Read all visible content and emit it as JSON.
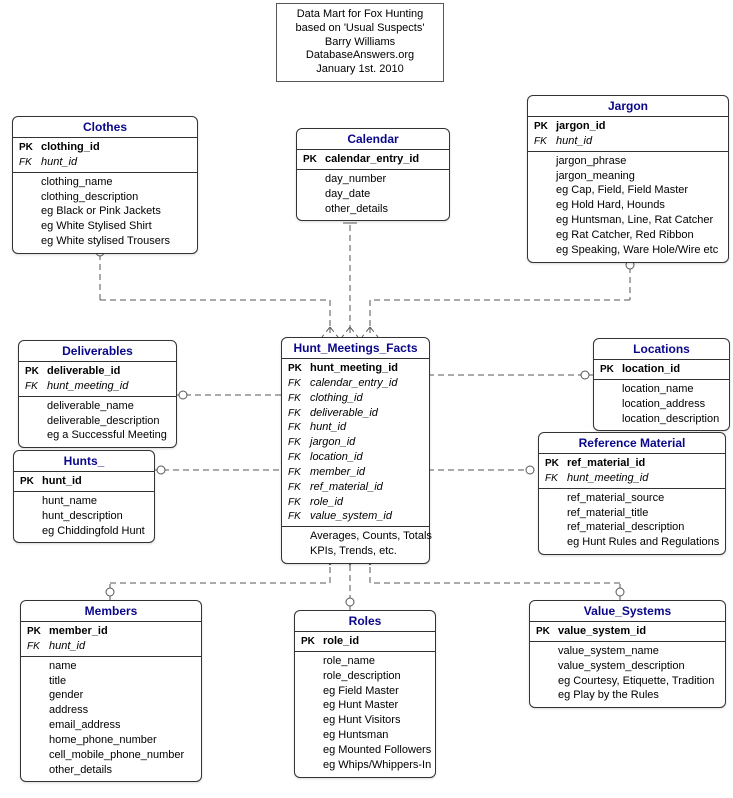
{
  "title_box": {
    "line1": "Data Mart for Fox Hunting",
    "line2": "based on 'Usual Suspects'",
    "line3": "Barry Williams",
    "line4": "DatabaseAnswers.org",
    "line5": "January 1st. 2010"
  },
  "entities": {
    "clothes": {
      "title": "Clothes",
      "rows": [
        {
          "key": "PK",
          "field": "clothing_id",
          "kind": "pk"
        },
        {
          "key": "FK",
          "field": "hunt_id",
          "kind": "fk"
        },
        {
          "key": "",
          "field": "clothing_name",
          "kind": "attr"
        },
        {
          "key": "",
          "field": "clothing_description",
          "kind": "attr"
        },
        {
          "key": "",
          "field": "eg Black or Pink Jackets",
          "kind": "attr"
        },
        {
          "key": "",
          "field": "eg White Stylised Shirt",
          "kind": "attr"
        },
        {
          "key": "",
          "field": "eg White stylised Trousers",
          "kind": "attr"
        }
      ]
    },
    "calendar": {
      "title": "Calendar",
      "rows": [
        {
          "key": "PK",
          "field": "calendar_entry_id",
          "kind": "pk"
        },
        {
          "key": "",
          "field": "day_number",
          "kind": "attr"
        },
        {
          "key": "",
          "field": "day_date",
          "kind": "attr"
        },
        {
          "key": "",
          "field": "other_details",
          "kind": "attr"
        }
      ]
    },
    "jargon": {
      "title": "Jargon",
      "rows": [
        {
          "key": "PK",
          "field": "jargon_id",
          "kind": "pk"
        },
        {
          "key": "FK",
          "field": "hunt_id",
          "kind": "fk"
        },
        {
          "key": "",
          "field": "jargon_phrase",
          "kind": "attr"
        },
        {
          "key": "",
          "field": "jargon_meaning",
          "kind": "attr"
        },
        {
          "key": "",
          "field": "eg Cap, Field, Field Master",
          "kind": "attr"
        },
        {
          "key": "",
          "field": "eg Hold Hard, Hounds",
          "kind": "attr"
        },
        {
          "key": "",
          "field": "eg Huntsman, Line, Rat Catcher",
          "kind": "attr"
        },
        {
          "key": "",
          "field": "eg Rat Catcher, Red Ribbon",
          "kind": "attr"
        },
        {
          "key": "",
          "field": "eg Speaking, Ware Hole/Wire etc",
          "kind": "attr"
        }
      ]
    },
    "deliverables": {
      "title": "Deliverables",
      "rows": [
        {
          "key": "PK",
          "field": "deliverable_id",
          "kind": "pk"
        },
        {
          "key": "FK",
          "field": "hunt_meeting_id",
          "kind": "fk"
        },
        {
          "key": "",
          "field": "deliverable_name",
          "kind": "attr"
        },
        {
          "key": "",
          "field": "deliverable_description",
          "kind": "attr"
        },
        {
          "key": "",
          "field": "eg a Successful Meeting",
          "kind": "attr"
        }
      ]
    },
    "facts": {
      "title": "Hunt_Meetings_Facts",
      "rows": [
        {
          "key": "PK",
          "field": "hunt_meeting_id",
          "kind": "pk"
        },
        {
          "key": "FK",
          "field": "calendar_entry_id",
          "kind": "fk"
        },
        {
          "key": "FK",
          "field": "clothing_id",
          "kind": "fk"
        },
        {
          "key": "FK",
          "field": "deliverable_id",
          "kind": "fk"
        },
        {
          "key": "FK",
          "field": "hunt_id",
          "kind": "fk"
        },
        {
          "key": "FK",
          "field": "jargon_id",
          "kind": "fk"
        },
        {
          "key": "FK",
          "field": "location_id",
          "kind": "fk"
        },
        {
          "key": "FK",
          "field": "member_id",
          "kind": "fk"
        },
        {
          "key": "FK",
          "field": "ref_material_id",
          "kind": "fk"
        },
        {
          "key": "FK",
          "field": "role_id",
          "kind": "fk"
        },
        {
          "key": "FK",
          "field": "value_system_id",
          "kind": "fk"
        },
        {
          "key": "",
          "field": "Averages, Counts, Totals",
          "kind": "attr"
        },
        {
          "key": "",
          "field": "KPIs, Trends, etc.",
          "kind": "attr"
        }
      ]
    },
    "locations": {
      "title": "Locations",
      "rows": [
        {
          "key": "PK",
          "field": "location_id",
          "kind": "pk"
        },
        {
          "key": "",
          "field": "location_name",
          "kind": "attr"
        },
        {
          "key": "",
          "field": "location_address",
          "kind": "attr"
        },
        {
          "key": "",
          "field": "location_description",
          "kind": "attr"
        }
      ]
    },
    "hunts": {
      "title": "Hunts_",
      "rows": [
        {
          "key": "PK",
          "field": "hunt_id",
          "kind": "pk"
        },
        {
          "key": "",
          "field": "hunt_name",
          "kind": "attr"
        },
        {
          "key": "",
          "field": "hunt_description",
          "kind": "attr"
        },
        {
          "key": "",
          "field": "eg Chiddingfold Hunt",
          "kind": "attr"
        }
      ]
    },
    "refmat": {
      "title": "Reference Material",
      "rows": [
        {
          "key": "PK",
          "field": "ref_material_id",
          "kind": "pk"
        },
        {
          "key": "FK",
          "field": "hunt_meeting_id",
          "kind": "fk"
        },
        {
          "key": "",
          "field": "ref_material_source",
          "kind": "attr"
        },
        {
          "key": "",
          "field": "ref_material_title",
          "kind": "attr"
        },
        {
          "key": "",
          "field": "ref_material_description",
          "kind": "attr"
        },
        {
          "key": "",
          "field": "eg Hunt Rules and Regulations",
          "kind": "attr"
        }
      ]
    },
    "members": {
      "title": "Members",
      "rows": [
        {
          "key": "PK",
          "field": "member_id",
          "kind": "pk"
        },
        {
          "key": "FK",
          "field": "hunt_id",
          "kind": "fk"
        },
        {
          "key": "",
          "field": "name",
          "kind": "attr"
        },
        {
          "key": "",
          "field": "title",
          "kind": "attr"
        },
        {
          "key": "",
          "field": "gender",
          "kind": "attr"
        },
        {
          "key": "",
          "field": "address",
          "kind": "attr"
        },
        {
          "key": "",
          "field": "email_address",
          "kind": "attr"
        },
        {
          "key": "",
          "field": "home_phone_number",
          "kind": "attr"
        },
        {
          "key": "",
          "field": "cell_mobile_phone_number",
          "kind": "attr"
        },
        {
          "key": "",
          "field": "other_details",
          "kind": "attr"
        }
      ]
    },
    "roles": {
      "title": "Roles",
      "rows": [
        {
          "key": "PK",
          "field": "role_id",
          "kind": "pk"
        },
        {
          "key": "",
          "field": "role_name",
          "kind": "attr"
        },
        {
          "key": "",
          "field": "role_description",
          "kind": "attr"
        },
        {
          "key": "",
          "field": "eg Field Master",
          "kind": "attr"
        },
        {
          "key": "",
          "field": "eg Hunt Master",
          "kind": "attr"
        },
        {
          "key": "",
          "field": "eg Hunt Visitors",
          "kind": "attr"
        },
        {
          "key": "",
          "field": "eg Huntsman",
          "kind": "attr"
        },
        {
          "key": "",
          "field": "eg Mounted Followers",
          "kind": "attr"
        },
        {
          "key": "",
          "field": "eg Whips/Whippers-In",
          "kind": "attr"
        }
      ]
    },
    "valuesys": {
      "title": "Value_Systems",
      "rows": [
        {
          "key": "PK",
          "field": "value_system_id",
          "kind": "pk"
        },
        {
          "key": "",
          "field": "value_system_name",
          "kind": "attr"
        },
        {
          "key": "",
          "field": "value_system_description",
          "kind": "attr"
        },
        {
          "key": "",
          "field": "eg Courtesy, Etiquette, Tradition",
          "kind": "attr"
        },
        {
          "key": "",
          "field": "eg Play by the Rules",
          "kind": "attr"
        }
      ]
    }
  }
}
